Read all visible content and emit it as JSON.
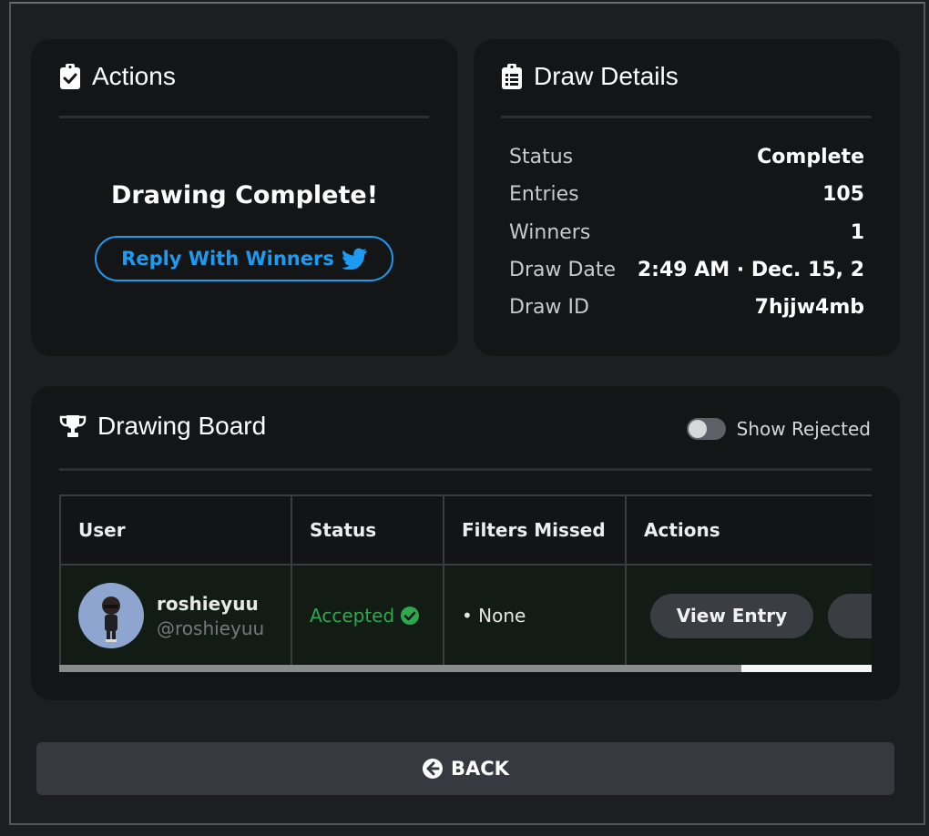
{
  "actions": {
    "title": "Actions",
    "complete_message": "Drawing Complete!",
    "reply_button": "Reply With Winners"
  },
  "details": {
    "title": "Draw Details",
    "rows": [
      {
        "label": "Status",
        "value": "Complete"
      },
      {
        "label": "Entries",
        "value": "105"
      },
      {
        "label": "Winners",
        "value": "1"
      },
      {
        "label": "Draw Date",
        "value": "2:49 AM · Dec. 15, 2"
      },
      {
        "label": "Draw ID",
        "value": "7hjjw4mb"
      }
    ]
  },
  "board": {
    "title": "Drawing Board",
    "toggle_label": "Show Rejected",
    "toggle_on": false,
    "columns": [
      "User",
      "Status",
      "Filters Missed",
      "Actions"
    ],
    "rows": [
      {
        "name": "roshieyuu",
        "handle": "@roshieyuu",
        "status": "Accepted",
        "filters": "• None",
        "action": "View Entry"
      }
    ],
    "scroll_fraction": 0.84
  },
  "back_button": "BACK",
  "colors": {
    "twitter": "#1d9bf0",
    "accepted": "#2ea84e",
    "card": "#141516",
    "background": "#1d1e21"
  },
  "icons": {
    "actions": "clipboard-check-icon",
    "details": "clipboard-list-icon",
    "board": "trophy-icon",
    "reply": "twitter-bird-icon",
    "status": "check-circle-icon",
    "back": "arrow-left-circle-icon"
  }
}
